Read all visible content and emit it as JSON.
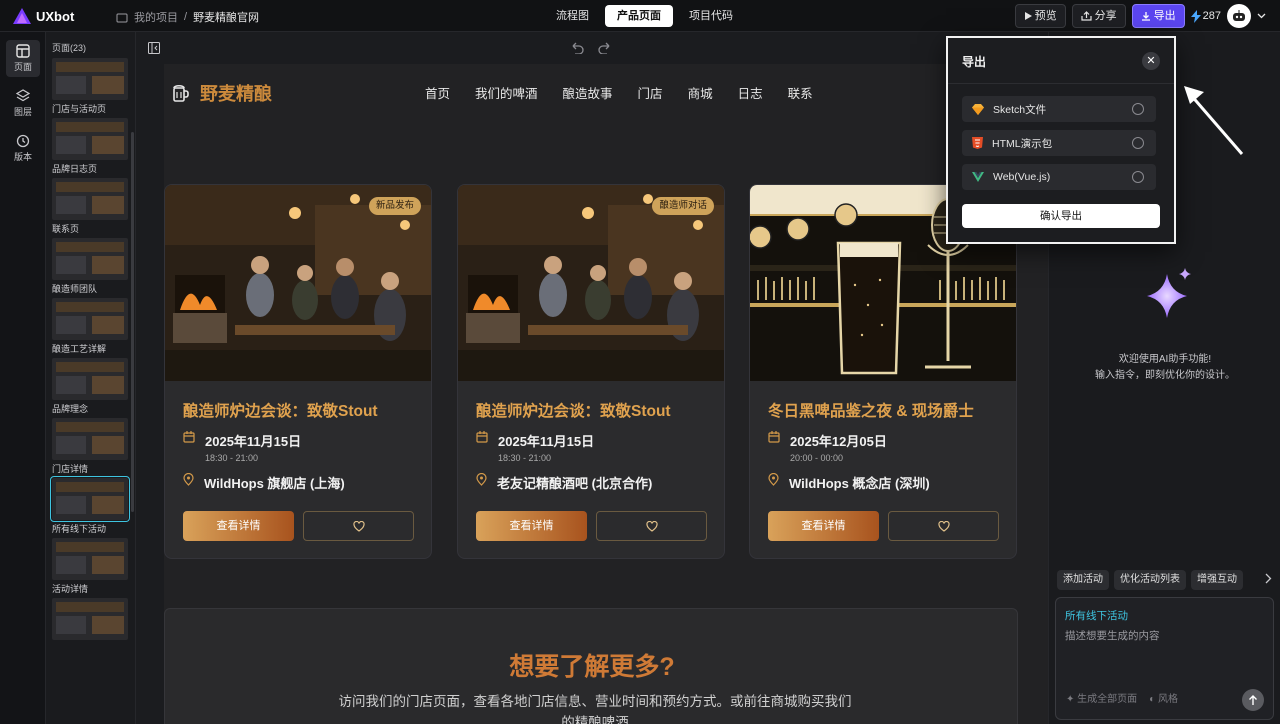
{
  "app": {
    "name": "UXbot"
  },
  "breadcrumb": {
    "root": "我的项目",
    "separator": "/",
    "current": "野麦精酿官网"
  },
  "top_tabs": [
    {
      "label": "流程图",
      "active": false
    },
    {
      "label": "产品页面",
      "active": true
    },
    {
      "label": "项目代码",
      "active": false
    }
  ],
  "top_actions": {
    "preview": "预览",
    "share": "分享",
    "export": "导出",
    "credits": "287"
  },
  "left_nav": [
    {
      "label": "页面",
      "icon": "layout-icon",
      "active": true
    },
    {
      "label": "图层",
      "icon": "layers-icon",
      "active": false
    },
    {
      "label": "版本",
      "icon": "history-icon",
      "active": false
    }
  ],
  "pages_panel": {
    "title": "页面(23)",
    "pages": [
      {
        "label": "门店与活动页",
        "selected": false
      },
      {
        "label": "品牌日志页",
        "selected": false
      },
      {
        "label": "联系页",
        "selected": false
      },
      {
        "label": "酿造师团队",
        "selected": false
      },
      {
        "label": "酿造工艺详解",
        "selected": false
      },
      {
        "label": "品牌理念",
        "selected": false
      },
      {
        "label": "门店详情",
        "selected": false
      },
      {
        "label": "所有线下活动",
        "selected": true
      },
      {
        "label": "活动详情",
        "selected": false
      }
    ]
  },
  "site": {
    "brand": "野麦精酿",
    "nav": [
      "首页",
      "我们的啤酒",
      "酿造故事",
      "门店",
      "商城",
      "日志",
      "联系"
    ],
    "cards": [
      {
        "badge": "新品发布",
        "title": "酿造师炉边会谈：致敬Stout",
        "date": "2025年11月15日",
        "time": "18:30 - 21:00",
        "location": "WildHops 旗舰店 (上海)",
        "detail_label": "查看详情",
        "image": "fireside-pub-photo"
      },
      {
        "badge": "酿造师对话",
        "title": "酿造师炉边会谈：致敬Stout",
        "date": "2025年11月15日",
        "time": "18:30 - 21:00",
        "location": "老友记精酿酒吧 (北京合作)",
        "detail_label": "查看详情",
        "image": "fireside-pub-photo"
      },
      {
        "badge": "",
        "title": "冬日黑啤品鉴之夜 & 现场爵士",
        "date": "2025年12月05日",
        "time": "20:00 - 00:00",
        "location": "WildHops 概念店 (深圳)",
        "detail_label": "查看详情",
        "image": "stout-microphone-illustration"
      }
    ],
    "more": {
      "title": "想要了解更多?",
      "desc": "访问我们的门店页面，查看各地门店信息、营业时间和预约方式。或前往商城购买我们的精酿啤酒"
    }
  },
  "assistant": {
    "welcome_line1": "欢迎使用AI助手功能!",
    "welcome_line2": "输入指令，即刻优化你的设计。",
    "chips": [
      "添加活动",
      "优化活动列表",
      "增强互动"
    ],
    "context": "所有线下活动",
    "placeholder": "描述想要生成的内容",
    "generate_all": "生成全部页面",
    "style": "风格"
  },
  "export_modal": {
    "title": "导出",
    "options": [
      {
        "label": "Sketch文件",
        "icon": "sketch-icon"
      },
      {
        "label": "HTML演示包",
        "icon": "html5-icon"
      },
      {
        "label": "Web(Vue.js)",
        "icon": "vue-icon"
      }
    ],
    "confirm": "确认导出"
  },
  "colors": {
    "accent": "#5b46f0",
    "brand_gold": "#e0a24e",
    "highlight": "#3ec4e0"
  }
}
